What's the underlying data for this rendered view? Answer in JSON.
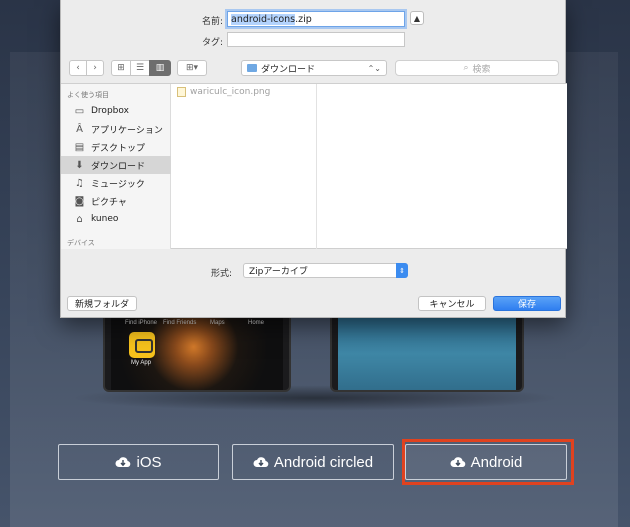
{
  "background_page": {
    "phone_left": {
      "app_labels": [
        "Find iPhone",
        "Find Friends",
        "Maps",
        "Home"
      ],
      "my_app_label": "My App"
    },
    "download_buttons": [
      {
        "label": "iOS"
      },
      {
        "label": "Android circled"
      },
      {
        "label": "Android"
      }
    ],
    "highlight_color": "#e0421f"
  },
  "dialog": {
    "name_label": "名前:",
    "filename_selected": "android-icons",
    "filename_ext": ".zip",
    "tag_label": "タグ:",
    "tag_value": "",
    "location": "ダウンロード",
    "search_placeholder": "検索",
    "sidebar": {
      "favorites_header": "よく使う項目",
      "items": [
        {
          "label": "Dropbox",
          "icon": "folder-icon"
        },
        {
          "label": "アプリケーション",
          "icon": "applications-icon"
        },
        {
          "label": "デスクトップ",
          "icon": "desktop-icon"
        },
        {
          "label": "ダウンロード",
          "icon": "download-icon",
          "selected": true
        },
        {
          "label": "ミュージック",
          "icon": "music-icon"
        },
        {
          "label": "ピクチャ",
          "icon": "camera-icon"
        },
        {
          "label": "kuneo",
          "icon": "home-icon"
        }
      ],
      "devices_header": "デバイス"
    },
    "files": [
      {
        "name": "wariculc_icon.png"
      }
    ],
    "format_label": "形式:",
    "format_value": "Zipアーカイブ",
    "new_folder_label": "新規フォルダ",
    "cancel_label": "キャンセル",
    "save_label": "保存",
    "accent_color": "#2f7ef0"
  }
}
